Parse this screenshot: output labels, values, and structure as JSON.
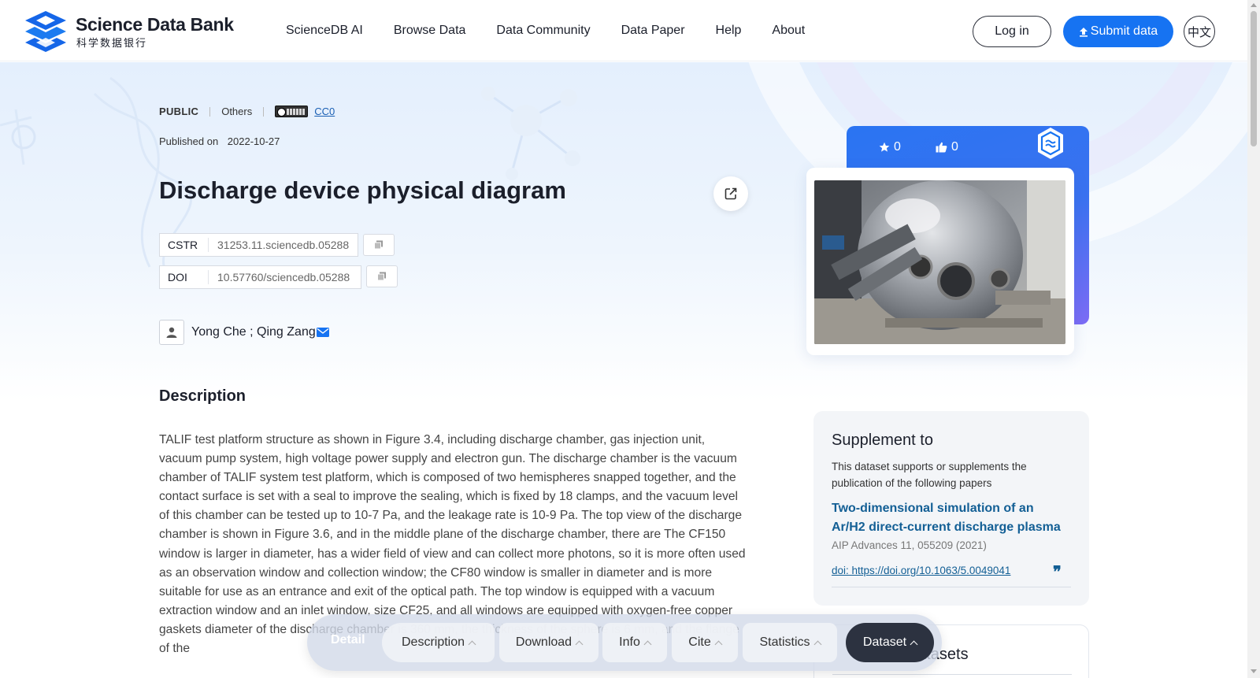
{
  "header": {
    "logo_en": "Science Data Bank",
    "logo_zh": "科学数据银行",
    "nav": [
      "ScienceDB AI",
      "Browse Data",
      "Data Community",
      "Data Paper",
      "Help",
      "About"
    ],
    "login_label": "Log in",
    "submit_label": "Submit data",
    "lang_label": "中文"
  },
  "dataset": {
    "visibility": "PUBLIC",
    "category": "Others",
    "license": "CC0",
    "published_label": "Published on",
    "published_date": "2022-10-27",
    "title": "Discharge device physical diagram",
    "cstr_label": "CSTR",
    "cstr_value": "31253.11.sciencedb.05288",
    "doi_label": "DOI",
    "doi_value": "10.57760/sciencedb.05288",
    "authors": "Yong Che ; Qing Zang",
    "stars": "0",
    "likes": "0"
  },
  "description": {
    "heading": "Description",
    "text": "TALIF test platform structure as shown in Figure 3.4, including discharge chamber, gas injection unit, vacuum pump system, high voltage power supply and electron gun. The discharge chamber is the vacuum chamber of TALIF system test platform, which is composed of two hemispheres snapped together, and the contact surface is set with a seal to improve the sealing, which is fixed by 18 clamps, and the vacuum level of this chamber can be tested up to 10-7 Pa, and the leakage rate is 10-9 Pa. The top view of the discharge chamber is shown in Figure 3.6, and in the middle plane of the discharge chamber, there are The CF150 window is larger in diameter, has a wider field of view and can collect more photons, so it is more often used as an observation window and collection window; the CF80 window is smaller in diameter and is more suitable for use as an entrance and exit of the optical path. The top window is equipped with a vacuum extraction window and an inlet window, size CF25, and all windows are equipped with oxygen-free copper gaskets diameter of the discharge chamber is 360 mm, the thickness of the sphere is 6 mm, and the flange of the"
  },
  "supplement": {
    "title": "Supplement to",
    "subtitle": "This dataset supports or supplements the publication of the following papers",
    "paper_title": "Two-dimensional simulation of an Ar/H2 direct-current discharge plasma",
    "journal": "AIP Advances 11, 055209 (2021)",
    "doi": "doi: https://doi.org/10.1063/5.0049041"
  },
  "related": {
    "title_visible": "datasets"
  },
  "floatbar": {
    "detail": "Detail",
    "buttons": [
      "Description",
      "Download",
      "Info",
      "Cite",
      "Statistics",
      "Dataset"
    ]
  },
  "colors": {
    "brand_blue": "#1673f2",
    "link_blue": "#135f95",
    "dark": "#2c3240"
  }
}
